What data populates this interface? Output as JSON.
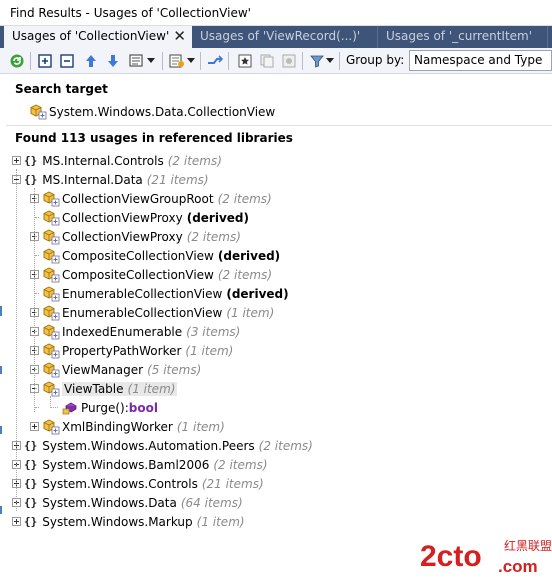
{
  "window": {
    "title": "Find Results - Usages of 'CollectionView'"
  },
  "tabs": [
    {
      "label": "Usages of 'CollectionView'",
      "active": true
    },
    {
      "label": "Usages of 'ViewRecord(...)'",
      "active": false
    },
    {
      "label": "Usages of '_currentItem'",
      "active": false
    }
  ],
  "tab_close_glyph": "✕",
  "toolbar": {
    "groupby_label": "Group by:",
    "groupby_value": "Namespace and Type"
  },
  "search_target": {
    "heading": "Search target",
    "item": "System.Windows.Data.CollectionView"
  },
  "found": {
    "heading": "Found 113 usages in referenced libraries"
  },
  "ns_icon_glyph": "{}",
  "tree": {
    "ns_controls": {
      "name": "MS.Internal.Controls",
      "count": "(2 items)"
    },
    "ns_data": {
      "name": "MS.Internal.Data",
      "count": "(21 items)"
    },
    "classes": [
      {
        "name": "CollectionViewGroupRoot",
        "count": "(2 items)",
        "derived": ""
      },
      {
        "name": "CollectionViewProxy",
        "count": "",
        "derived": "(derived)"
      },
      {
        "name": "CollectionViewProxy",
        "count": "(2 items)",
        "derived": ""
      },
      {
        "name": "CompositeCollectionView",
        "count": "",
        "derived": "(derived)"
      },
      {
        "name": "CompositeCollectionView",
        "count": "(2 items)",
        "derived": ""
      },
      {
        "name": "EnumerableCollectionView",
        "count": "",
        "derived": "(derived)"
      },
      {
        "name": "EnumerableCollectionView",
        "count": "(1 item)",
        "derived": ""
      },
      {
        "name": "IndexedEnumerable",
        "count": "(3 items)",
        "derived": ""
      },
      {
        "name": "PropertyPathWorker",
        "count": "(1 item)",
        "derived": ""
      },
      {
        "name": "ViewManager",
        "count": "(5 items)",
        "derived": ""
      },
      {
        "name": "ViewTable",
        "count": "(1 item)",
        "derived": ""
      }
    ],
    "method": {
      "name": "Purge():",
      "type": "bool"
    },
    "xml_worker": {
      "name": "XmlBindingWorker",
      "count": "(1 item)"
    },
    "namespaces": [
      {
        "name": "System.Windows.Automation.Peers",
        "count": "(2 items)"
      },
      {
        "name": "System.Windows.Baml2006",
        "count": "(2 items)"
      },
      {
        "name": "System.Windows.Controls",
        "count": "(21 items)"
      },
      {
        "name": "System.Windows.Data",
        "count": "(64 items)"
      },
      {
        "name": "System.Windows.Markup",
        "count": "(1 item)"
      }
    ]
  },
  "watermark": {
    "brand": "2cto",
    "suffix": ".com",
    "cn": "红黑联盟"
  },
  "colors": {
    "tab_strip": "#3f5479",
    "active_tab": "#f3f4f9",
    "count_text": "#8a8a8a",
    "method_type": "#7a2aa8",
    "watermark_red": "#d42020"
  }
}
